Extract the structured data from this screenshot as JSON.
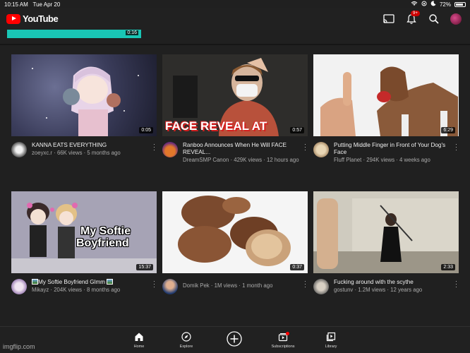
{
  "status": {
    "time": "10:15 AM",
    "date": "Tue Apr 20",
    "battery": "72%"
  },
  "header": {
    "logo_text": "YouTube",
    "notification_count": "9+"
  },
  "strip": {
    "duration": "0:16"
  },
  "videos": [
    {
      "title": "KANNA EATS EVERYTHING",
      "channel": "zoeyxc.r",
      "stats": "66K views · 5 months ago",
      "duration": "0:05"
    },
    {
      "title": "Ranboo Announces When He Will FACE REVEAL...",
      "channel": "DreamSMP Canon",
      "stats": "429K views · 12 hours ago",
      "duration": "0:57",
      "overlay": "FACE REVEAL AT"
    },
    {
      "title": "Putting Middle Finger in Front of Your Dog's Face",
      "channel": "Fluff Planet",
      "stats": "294K views · 4 weeks ago",
      "duration": "6:29"
    },
    {
      "title": "My Softie Boyfriend Glmm",
      "channel": "Mikayz",
      "stats": "204K views · 8 months ago",
      "duration": "15:37",
      "overlay1": "My Softie",
      "overlay2": "Boyfriend"
    },
    {
      "title": "",
      "channel": "Domik Pek",
      "stats": "1M views · 1 month ago",
      "duration": "0:37"
    },
    {
      "title": "Fucking around with the scythe",
      "channel": "gostunv",
      "stats": "1.2M views · 12 years ago",
      "duration": "2:33"
    }
  ],
  "nav": {
    "home": "Home",
    "explore": "Explore",
    "subscriptions": "Subscriptions",
    "library": "Library"
  },
  "watermark": "imgflip.com",
  "colors": {
    "brand": "#ff0000",
    "background": "#202020",
    "secondary_text": "#aaaaaa"
  },
  "icons": [
    "cast-icon",
    "bell-icon",
    "search-icon",
    "home-icon",
    "explore-icon",
    "create-icon",
    "subscriptions-icon",
    "library-icon"
  ]
}
